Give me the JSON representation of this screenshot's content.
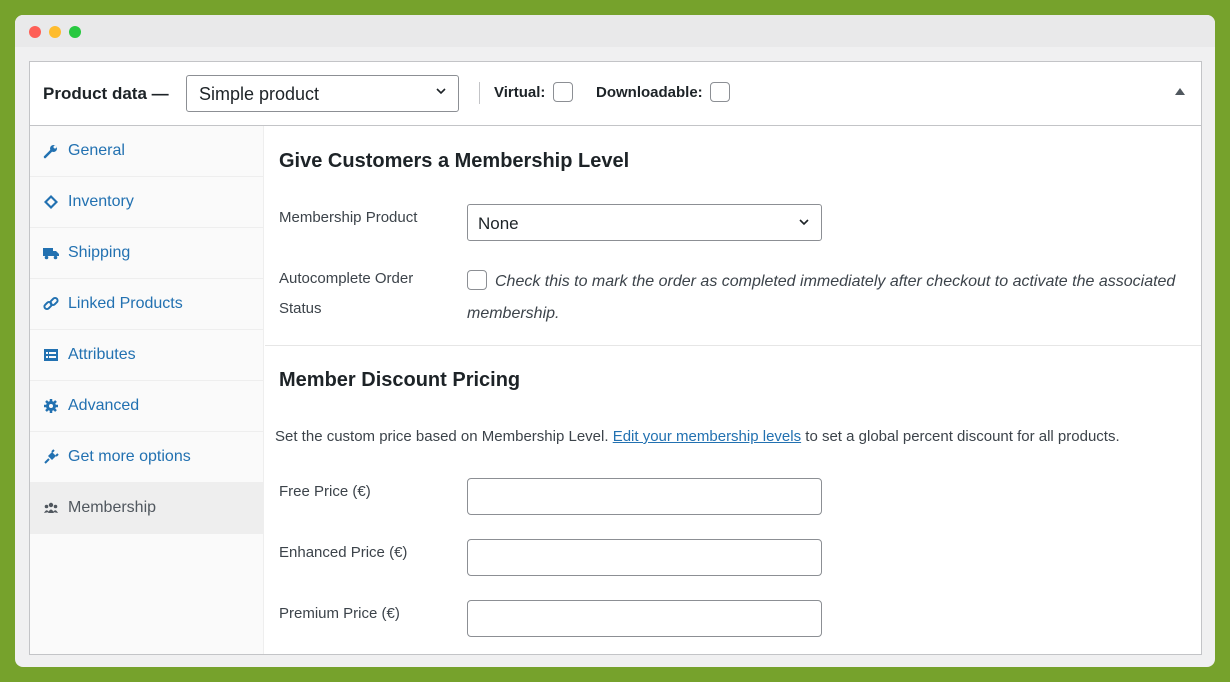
{
  "header": {
    "title": "Product data —",
    "product_type": "Simple product",
    "virtual_label": "Virtual:",
    "downloadable_label": "Downloadable:"
  },
  "sidebar": {
    "items": [
      {
        "label": "General",
        "icon": "wrench-icon"
      },
      {
        "label": "Inventory",
        "icon": "tag-icon"
      },
      {
        "label": "Shipping",
        "icon": "truck-icon"
      },
      {
        "label": "Linked Products",
        "icon": "link-icon"
      },
      {
        "label": "Attributes",
        "icon": "list-icon"
      },
      {
        "label": "Advanced",
        "icon": "gear-icon"
      },
      {
        "label": "Get more options",
        "icon": "plugin-icon"
      },
      {
        "label": "Membership",
        "icon": "groups-icon",
        "active": true
      }
    ]
  },
  "membership": {
    "section_title": "Give Customers a Membership Level",
    "product_label": "Membership Product",
    "product_value": "None",
    "autocomplete_label_1": "Autocomplete Order",
    "autocomplete_label_2": "Status",
    "autocomplete_desc": "Check this to mark the order as completed immediately after checkout to activate the associated membership."
  },
  "discount": {
    "section_title": "Member Discount Pricing",
    "help_prefix": "Set the custom price based on Membership Level.",
    "help_link": "Edit your membership levels",
    "help_suffix": "to set a global percent discount for all products.",
    "fields": [
      {
        "label": "Free Price (€)",
        "value": ""
      },
      {
        "label": "Enhanced Price (€)",
        "value": ""
      },
      {
        "label": "Premium Price (€)",
        "value": ""
      }
    ]
  },
  "colors": {
    "background": "#76a22c",
    "link": "#2271b1"
  }
}
